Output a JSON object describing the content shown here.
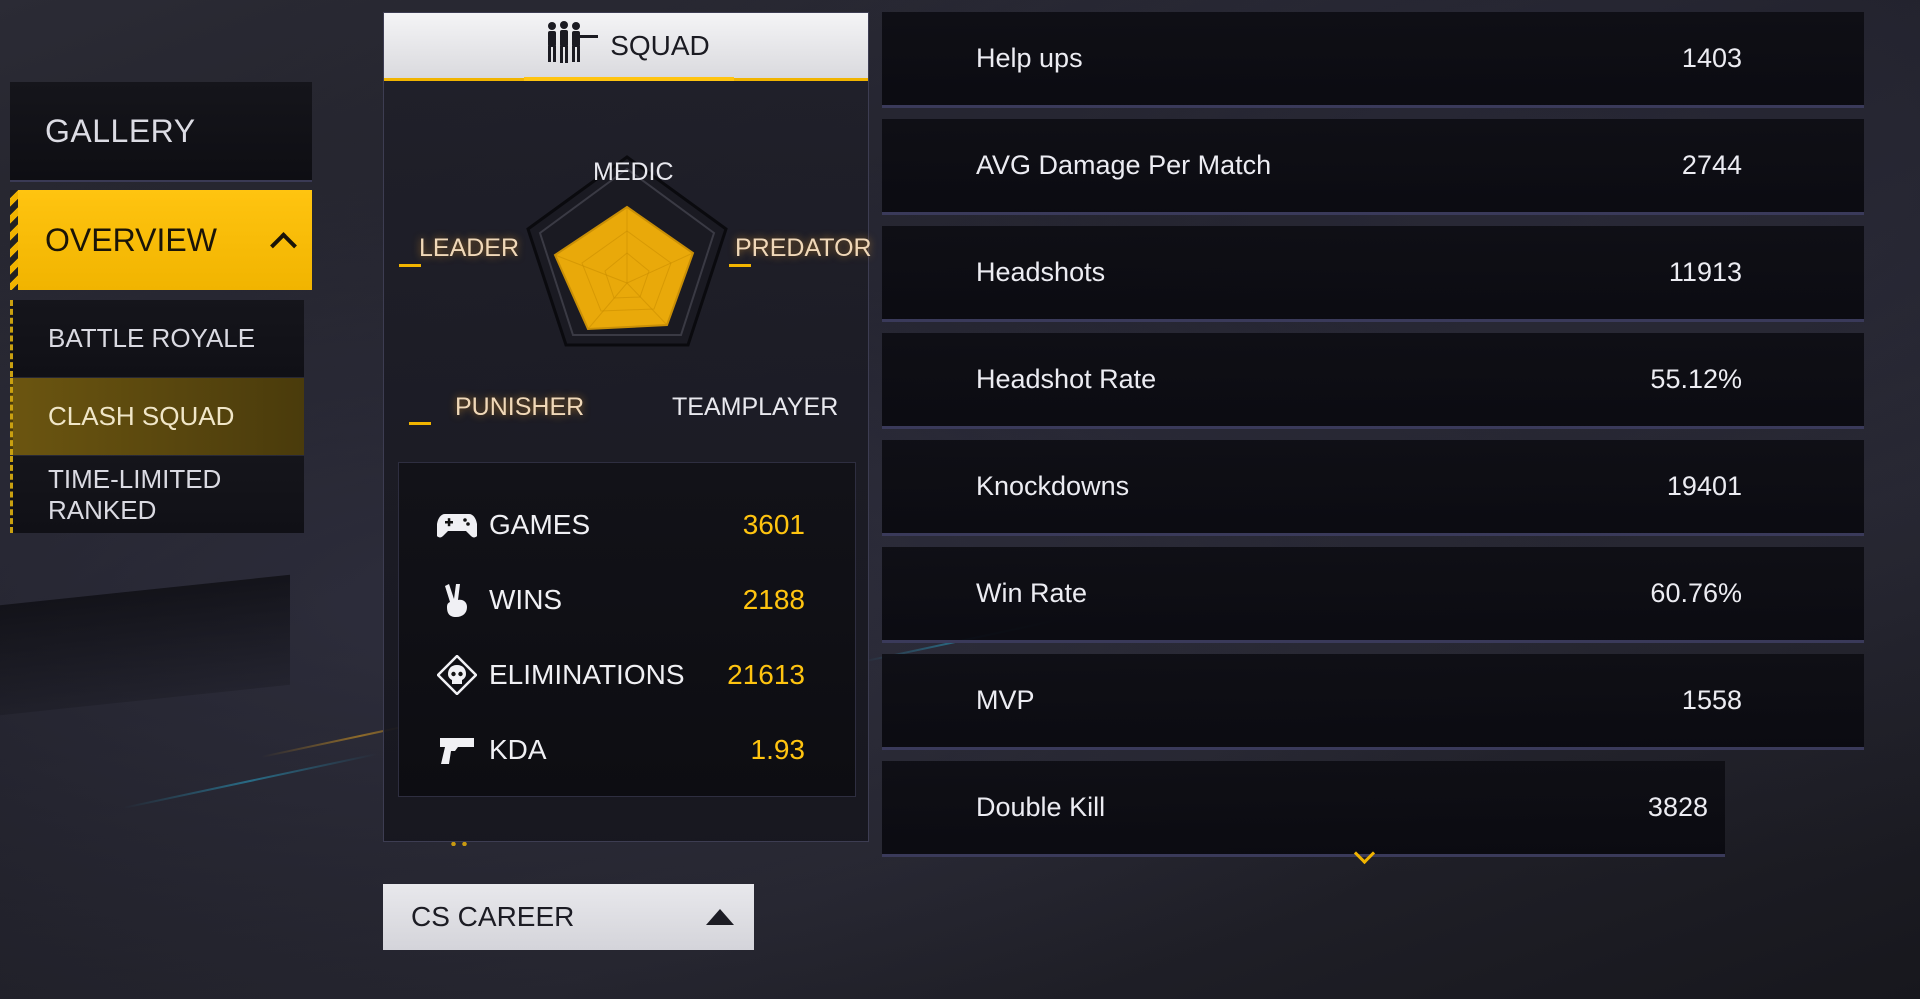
{
  "nav": {
    "gallery": "GALLERY",
    "overview": "OVERVIEW",
    "sub_items": [
      {
        "label": "BATTLE ROYALE"
      },
      {
        "label": "CLASH SQUAD"
      },
      {
        "label": "TIME-LIMITED RANKED"
      }
    ]
  },
  "squad": {
    "title": "SQUAD",
    "radar": {
      "labels": {
        "medic": "MEDIC",
        "leader": "LEADER",
        "predator": "PREDATOR",
        "punisher": "PUNISHER",
        "teamplayer": "TEAMPLAYER"
      }
    },
    "stats": [
      {
        "label": "GAMES",
        "value": "3601",
        "icon": "gamepad-icon"
      },
      {
        "label": "WINS",
        "value": "2188",
        "icon": "victory-hand-icon"
      },
      {
        "label": "ELIMINATIONS",
        "value": "21613",
        "icon": "skull-icon"
      },
      {
        "label": "KDA",
        "value": "1.93",
        "icon": "pistol-icon"
      }
    ]
  },
  "career_button": {
    "label": "CS CAREER"
  },
  "metrics": [
    {
      "label": "Help ups",
      "value": "1403"
    },
    {
      "label": "AVG Damage Per Match",
      "value": "2744"
    },
    {
      "label": "Headshots",
      "value": "11913"
    },
    {
      "label": "Headshot Rate",
      "value": "55.12%"
    },
    {
      "label": "Knockdowns",
      "value": "19401"
    },
    {
      "label": "Win Rate",
      "value": "60.76%"
    },
    {
      "label": "MVP",
      "value": "1558"
    },
    {
      "label": "Double Kill",
      "value": "3828"
    }
  ],
  "colors": {
    "accent": "#ffc410",
    "panel": "#101016"
  }
}
